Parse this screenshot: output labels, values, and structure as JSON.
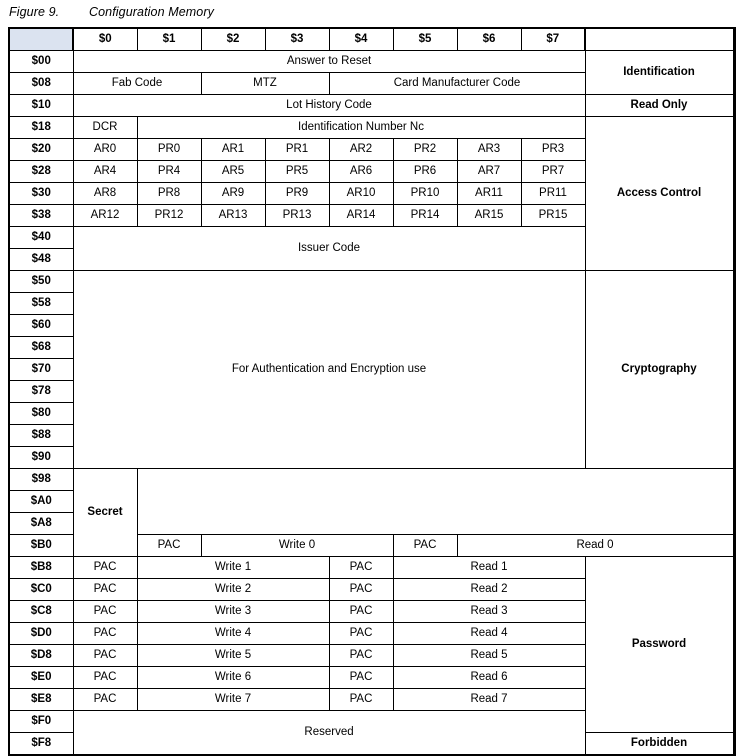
{
  "figure": {
    "number": "Figure 9.",
    "title": "Configuration Memory"
  },
  "table": {
    "corner_header": "",
    "column_headers": [
      "$0",
      "$1",
      "$2",
      "$3",
      "$4",
      "$5",
      "$6",
      "$7"
    ],
    "zone_header": "",
    "colors": {
      "header_fill": "#dbe3f0",
      "address_fill": "#dbe3f0",
      "cell_fill": "#ffffff",
      "border": "#000000"
    },
    "addresses": [
      "$00",
      "$08",
      "$10",
      "$18",
      "$20",
      "$28",
      "$30",
      "$38",
      "$40",
      "$48",
      "$50",
      "$58",
      "$60",
      "$68",
      "$70",
      "$78",
      "$80",
      "$88",
      "$90",
      "$98",
      "$A0",
      "$A8",
      "$B0",
      "$B8",
      "$C0",
      "$C8",
      "$D0",
      "$D8",
      "$E0",
      "$E8",
      "$F0",
      "$F8"
    ],
    "zones": [
      {
        "label": "Identification",
        "rows": 2
      },
      {
        "label": "Read Only",
        "rows": 1
      },
      {
        "label": "Access Control",
        "rows": 7
      },
      {
        "label": "Cryptography",
        "rows": 9
      },
      {
        "label": "Secret",
        "rows": 4
      },
      {
        "label": "Password",
        "rows": 8
      },
      {
        "label": "Forbidden",
        "rows": 2
      }
    ],
    "rows": [
      {
        "address": "$00",
        "cells": [
          {
            "text": "Answer to Reset",
            "span": 8
          }
        ]
      },
      {
        "address": "$08",
        "cells": [
          {
            "text": "Fab Code",
            "span": 2
          },
          {
            "text": "MTZ",
            "span": 2
          },
          {
            "text": "Card Manufacturer Code",
            "span": 4
          }
        ]
      },
      {
        "address": "$10",
        "cells": [
          {
            "text": "Lot History Code",
            "span": 8
          }
        ]
      },
      {
        "address": "$18",
        "cells": [
          {
            "text": "DCR",
            "span": 1
          },
          {
            "text": "Identification Number Nc",
            "span": 7
          }
        ]
      },
      {
        "address": "$20",
        "cells": [
          {
            "text": "AR0",
            "span": 1
          },
          {
            "text": "PR0",
            "span": 1
          },
          {
            "text": "AR1",
            "span": 1
          },
          {
            "text": "PR1",
            "span": 1
          },
          {
            "text": "AR2",
            "span": 1
          },
          {
            "text": "PR2",
            "span": 1
          },
          {
            "text": "AR3",
            "span": 1
          },
          {
            "text": "PR3",
            "span": 1
          }
        ]
      },
      {
        "address": "$28",
        "cells": [
          {
            "text": "AR4",
            "span": 1
          },
          {
            "text": "PR4",
            "span": 1
          },
          {
            "text": "AR5",
            "span": 1
          },
          {
            "text": "PR5",
            "span": 1
          },
          {
            "text": "AR6",
            "span": 1
          },
          {
            "text": "PR6",
            "span": 1
          },
          {
            "text": "AR7",
            "span": 1
          },
          {
            "text": "PR7",
            "span": 1
          }
        ]
      },
      {
        "address": "$30",
        "cells": [
          {
            "text": "AR8",
            "span": 1
          },
          {
            "text": "PR8",
            "span": 1
          },
          {
            "text": "AR9",
            "span": 1
          },
          {
            "text": "PR9",
            "span": 1
          },
          {
            "text": "AR10",
            "span": 1
          },
          {
            "text": "PR10",
            "span": 1
          },
          {
            "text": "AR11",
            "span": 1
          },
          {
            "text": "PR11",
            "span": 1
          }
        ]
      },
      {
        "address": "$38",
        "cells": [
          {
            "text": "AR12",
            "span": 1
          },
          {
            "text": "PR12",
            "span": 1
          },
          {
            "text": "AR13",
            "span": 1
          },
          {
            "text": "PR13",
            "span": 1
          },
          {
            "text": "AR14",
            "span": 1
          },
          {
            "text": "PR14",
            "span": 1
          },
          {
            "text": "AR15",
            "span": 1
          },
          {
            "text": "PR15",
            "span": 1
          }
        ]
      },
      {
        "address": "$40",
        "cells": [
          {
            "text": "Issuer Code",
            "span": 8,
            "rowspan": 2
          }
        ]
      },
      {
        "address": "$48",
        "cells": []
      },
      {
        "address": "$50",
        "cells": [
          {
            "text": "For Authentication and Encryption use",
            "span": 8,
            "rowspan": 9
          }
        ]
      },
      {
        "address": "$58",
        "cells": []
      },
      {
        "address": "$60",
        "cells": []
      },
      {
        "address": "$68",
        "cells": []
      },
      {
        "address": "$70",
        "cells": []
      },
      {
        "address": "$78",
        "cells": []
      },
      {
        "address": "$80",
        "cells": []
      },
      {
        "address": "$88",
        "cells": []
      },
      {
        "address": "$90",
        "cells": [
          {
            "text": "For Authentication and Encryption use",
            "span": 8,
            "rowspan": 4
          }
        ]
      },
      {
        "address": "$98",
        "cells": []
      },
      {
        "address": "$A0",
        "cells": []
      },
      {
        "address": "$A8",
        "cells": []
      },
      {
        "address": "$B0",
        "cells": [
          {
            "text": "PAC",
            "span": 1
          },
          {
            "text": "Write 0",
            "span": 3
          },
          {
            "text": "PAC",
            "span": 1
          },
          {
            "text": "Read 0",
            "span": 3
          }
        ]
      },
      {
        "address": "$B8",
        "cells": [
          {
            "text": "PAC",
            "span": 1
          },
          {
            "text": "Write 1",
            "span": 3
          },
          {
            "text": "PAC",
            "span": 1
          },
          {
            "text": "Read 1",
            "span": 3
          }
        ]
      },
      {
        "address": "$C0",
        "cells": [
          {
            "text": "PAC",
            "span": 1
          },
          {
            "text": "Write 2",
            "span": 3
          },
          {
            "text": "PAC",
            "span": 1
          },
          {
            "text": "Read 2",
            "span": 3
          }
        ]
      },
      {
        "address": "$C8",
        "cells": [
          {
            "text": "PAC",
            "span": 1
          },
          {
            "text": "Write 3",
            "span": 3
          },
          {
            "text": "PAC",
            "span": 1
          },
          {
            "text": "Read 3",
            "span": 3
          }
        ]
      },
      {
        "address": "$D0",
        "cells": [
          {
            "text": "PAC",
            "span": 1
          },
          {
            "text": "Write 4",
            "span": 3
          },
          {
            "text": "PAC",
            "span": 1
          },
          {
            "text": "Read 4",
            "span": 3
          }
        ]
      },
      {
        "address": "$D8",
        "cells": [
          {
            "text": "PAC",
            "span": 1
          },
          {
            "text": "Write 5",
            "span": 3
          },
          {
            "text": "PAC",
            "span": 1
          },
          {
            "text": "Read 5",
            "span": 3
          }
        ]
      },
      {
        "address": "$E0",
        "cells": [
          {
            "text": "PAC",
            "span": 1
          },
          {
            "text": "Write 6",
            "span": 3
          },
          {
            "text": "PAC",
            "span": 1
          },
          {
            "text": "Read 6",
            "span": 3
          }
        ]
      },
      {
        "address": "$E8",
        "cells": [
          {
            "text": "PAC",
            "span": 1
          },
          {
            "text": "Write 7",
            "span": 3
          },
          {
            "text": "PAC",
            "span": 1
          },
          {
            "text": "Read 7",
            "span": 3
          }
        ]
      },
      {
        "address": "$F0",
        "cells": [
          {
            "text": "Reserved",
            "span": 8,
            "rowspan": 2
          }
        ]
      },
      {
        "address": "$F8",
        "cells": []
      }
    ]
  }
}
